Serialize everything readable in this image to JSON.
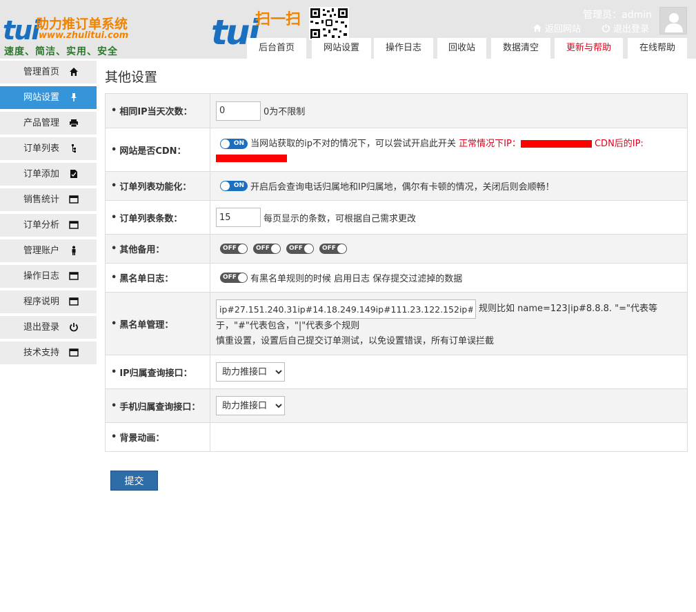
{
  "header": {
    "logo": {
      "brand": "tui",
      "title": "助力推订单系统",
      "url": "www.zhulitui.com",
      "slogan": "速度、简洁、实用、安全"
    },
    "scan": {
      "brand": "tui",
      "text": "扫一扫"
    },
    "admin_label": "管理员：admin",
    "back_site": "返回网站",
    "logout": "退出登录"
  },
  "tabs": [
    {
      "label": "后台首页"
    },
    {
      "label": "网站设置"
    },
    {
      "label": "操作日志"
    },
    {
      "label": "回收站"
    },
    {
      "label": "数据清空"
    },
    {
      "label": "更新与帮助",
      "color": "#e0001a"
    },
    {
      "label": "在线帮助"
    }
  ],
  "sidebar": {
    "items": [
      {
        "label": "管理首页",
        "icon": "home-icon"
      },
      {
        "label": "网站设置",
        "icon": "pin-icon",
        "active": true
      },
      {
        "label": "产品管理",
        "icon": "printer-icon"
      },
      {
        "label": "订单列表",
        "icon": "tree-icon"
      },
      {
        "label": "订单添加",
        "icon": "document-icon"
      },
      {
        "label": "销售统计",
        "icon": "window-icon"
      },
      {
        "label": "订单分析",
        "icon": "window-icon"
      },
      {
        "label": "管理账户",
        "icon": "person-icon"
      },
      {
        "label": "操作日志",
        "icon": "window-icon"
      },
      {
        "label": "程序说明",
        "icon": "window-icon"
      },
      {
        "label": "退出登录",
        "icon": "power-icon"
      },
      {
        "label": "技术支持",
        "icon": "window-icon"
      }
    ]
  },
  "page": {
    "title": "其他设置",
    "rows": {
      "same_ip": {
        "label": "相同IP当天次数：",
        "value": "0",
        "note": "0为不限制"
      },
      "cdn": {
        "label": "网站是否CDN：",
        "toggle": "ON",
        "note": "当网站获取的ip不对的情况下，可以尝试开启此开关",
        "normal_ip_label": "正常情况下IP：",
        "cdn_ip_label": "CDN后的IP:"
      },
      "order_func": {
        "label": "订单列表功能化：",
        "toggle": "ON",
        "note": "开启后会查询电话归属地和IP归属地，偶尔有卡顿的情况，关闭后则会顺畅！"
      },
      "order_count": {
        "label": "订单列表条数：",
        "value": "15",
        "note": "每页显示的条数，可根据自己需求更改"
      },
      "other_backup": {
        "label": "其他备用：",
        "toggles": [
          "OFF",
          "OFF",
          "OFF",
          "OFF"
        ]
      },
      "blacklist_log": {
        "label": "黑名单日志：",
        "toggle": "OFF",
        "note": "有黑名单规则的时候 启用日志 保存提交过滤掉的数据"
      },
      "blacklist_mgmt": {
        "label": "黑名单管理：",
        "value": "ip#27.151.240.31ip#14.18.249.149ip#111.23.122.152ip#",
        "rule_note_1": "规则比如 name=123|ip#8.8.8. \"=\"代表等",
        "rule_note_2": "于，\"#\"代表包含，\"|\"代表多个规则",
        "rule_note_3": "慎重设置，设置后自己提交订单测试，以免设置错误，所有订单误拦截"
      },
      "ip_api": {
        "label": "IP归属查询接口：",
        "selected": "助力推接口"
      },
      "phone_api": {
        "label": "手机归属查询接口：",
        "selected": "助力推接口"
      },
      "bg_anim": {
        "label": "背景动画："
      }
    },
    "submit_label": "提交"
  },
  "colors": {
    "header_bg": "#e6e6e6",
    "sidebar_active": "#3694d9",
    "toggle_on": "#1a6fbf",
    "toggle_off": "#555555",
    "accent_red": "#e0001a",
    "brand_orange": "#f08300",
    "brand_blue": "#1a6fbf",
    "submit_bg": "#2f6da8"
  }
}
